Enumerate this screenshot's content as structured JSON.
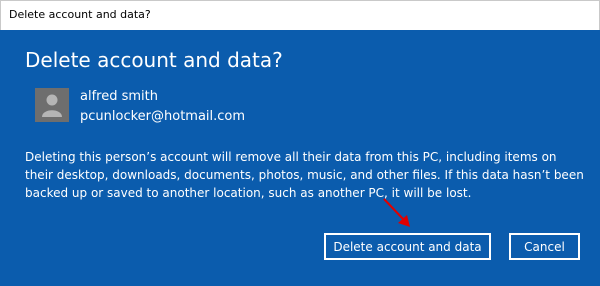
{
  "window": {
    "title": "Delete account and data?"
  },
  "dialog": {
    "heading": "Delete account and data?",
    "user": {
      "name": "alfred smith",
      "email": "pcunlocker@hotmail.com",
      "avatar_icon": "user-silhouette-icon"
    },
    "message": "Deleting this person’s account will remove all their data from this PC, including items on their desktop, downloads, documents, photos, music, and other files. If this data hasn’t been backed up or saved to another location, such as another PC, it will be lost.",
    "buttons": {
      "delete_label": "Delete account and data",
      "cancel_label": "Cancel"
    }
  },
  "colors": {
    "dialog_bg": "#0b5cad",
    "text": "#ffffff",
    "annotation_arrow": "#e00000"
  }
}
